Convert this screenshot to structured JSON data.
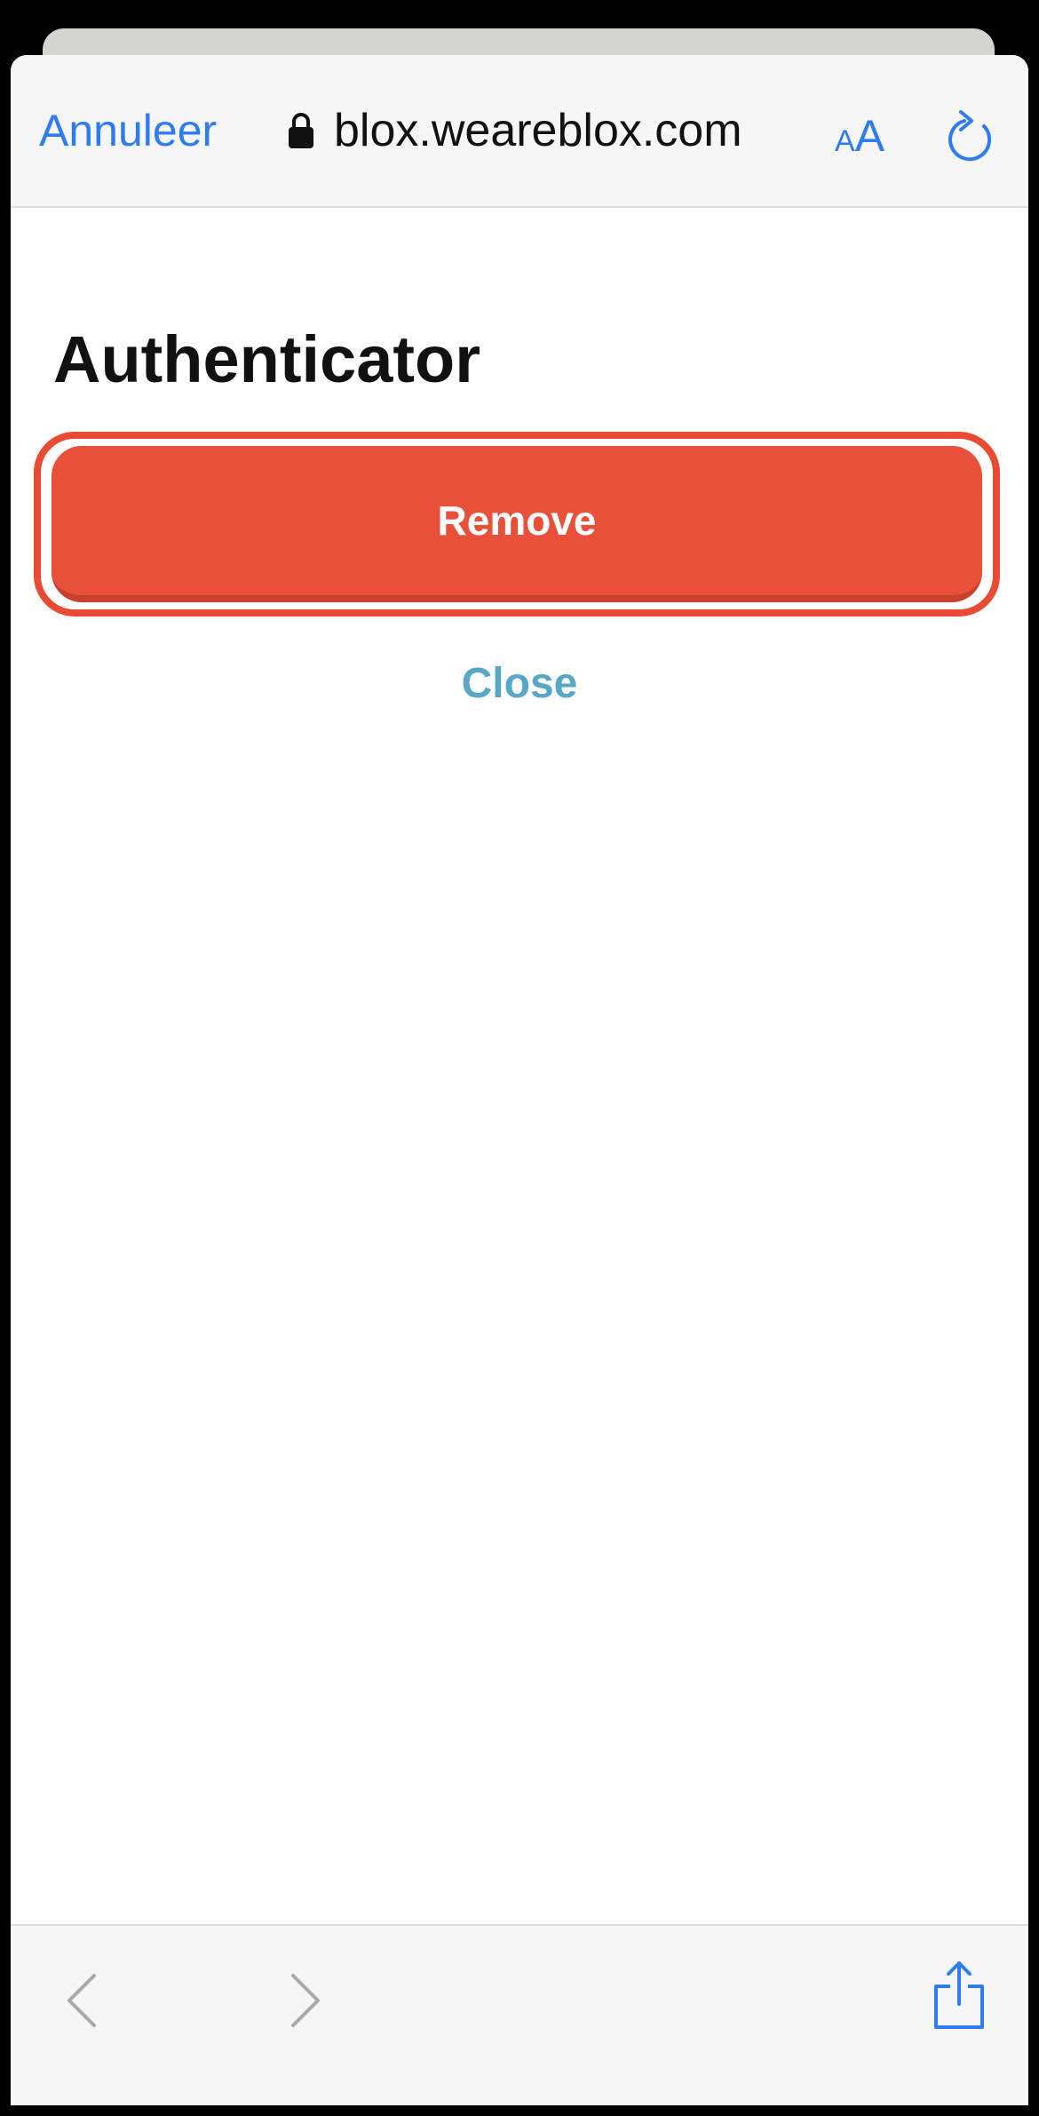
{
  "browser": {
    "cancel_label": "Annuleer",
    "url": "blox.weareblox.com",
    "text_size_small": "A",
    "text_size_big": "A",
    "accent_color": "#2f7bf0"
  },
  "page": {
    "title": "Authenticator",
    "remove_label": "Remove",
    "close_label": "Close",
    "remove_color": "#e9503a",
    "close_color": "#56a8c6"
  },
  "icons": {
    "lock": "lock-icon",
    "reload": "reload-icon",
    "back": "chevron-left-icon",
    "forward": "chevron-right-icon",
    "share": "share-icon"
  }
}
